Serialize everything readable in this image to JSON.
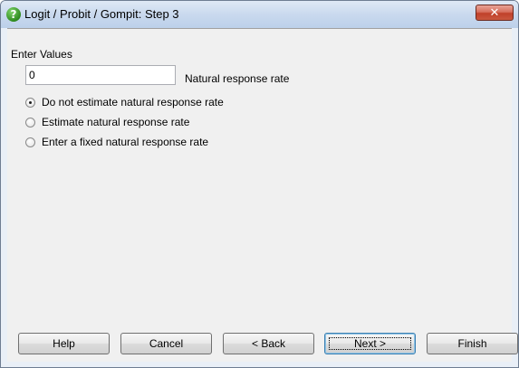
{
  "window": {
    "title": "Logit / Probit / Gompit: Step 3",
    "app_icon": "help-question-icon",
    "close_glyph": "✕"
  },
  "form": {
    "section_label": "Enter Values",
    "natural_response": {
      "value": "0",
      "caption": "Natural response rate"
    },
    "options": [
      {
        "label": "Do not estimate natural response rate",
        "selected": true
      },
      {
        "label": "Estimate natural response rate",
        "selected": false
      },
      {
        "label": "Enter a fixed natural response rate",
        "selected": false
      }
    ]
  },
  "buttons": {
    "help": "Help",
    "cancel": "Cancel",
    "back": "< Back",
    "next": "Next >",
    "finish": "Finish"
  }
}
